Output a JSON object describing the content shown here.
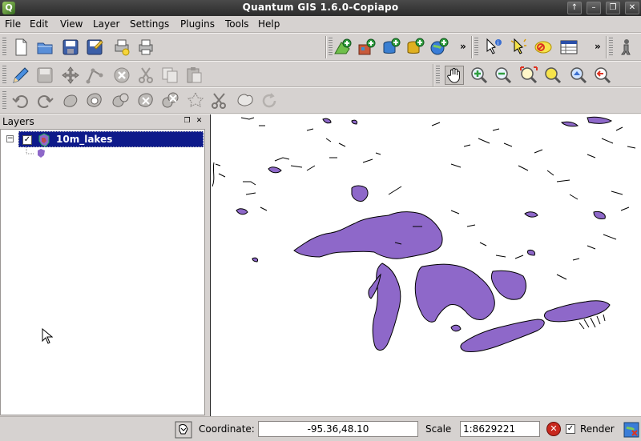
{
  "window": {
    "title": "Quantum GIS 1.6.0-Copiapo",
    "app_icon_letter": "Q",
    "buttons": {
      "up": "↑",
      "minimize": "–",
      "restore": "❐",
      "close": "✕"
    }
  },
  "menubar": {
    "items": [
      "File",
      "Edit",
      "View",
      "Layer",
      "Settings",
      "Plugins",
      "Tools",
      "Help"
    ]
  },
  "toolbar_overflow": "»",
  "layers_panel": {
    "title": "Layers",
    "float_glyph": "❐",
    "close_glyph": "✕",
    "expander_glyph": "−",
    "layers": [
      {
        "name": "10m_lakes",
        "checked": true,
        "check_glyph": "✓",
        "fill_color": "#8e68c9"
      }
    ]
  },
  "map": {
    "lake_fill": "#8e68c9",
    "outline": "#000000",
    "background": "#ffffff"
  },
  "statusbar": {
    "coordinate_label": "Coordinate:",
    "coordinate_value": "-95.36,48.10",
    "scale_label": "Scale",
    "scale_value": "1:8629221",
    "render_label": "Render",
    "render_checked": true,
    "render_check_glyph": "✓",
    "stop_glyph": "✕"
  },
  "colors": {
    "selection": "#0e1a8a",
    "chrome": "#d6d2d0",
    "titlebar": "#2b2b2b"
  }
}
